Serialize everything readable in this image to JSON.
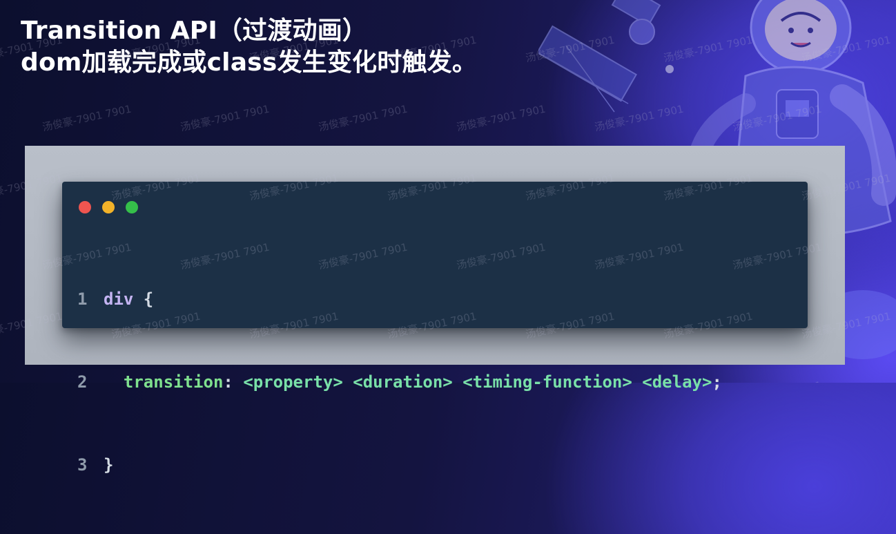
{
  "slide": {
    "title_line1": "Transition API（过渡动画）",
    "title_line2": "dom加载完成或class发生变化时触发。"
  },
  "code_window": {
    "lines": [
      {
        "num": "1",
        "selector": "div",
        "brace": " {"
      },
      {
        "num": "2",
        "indent": "  ",
        "property": "transition",
        "colon": ": ",
        "value": "<property> <duration> <timing-function> <delay>",
        "semi": ";"
      },
      {
        "num": "3",
        "brace": "}"
      }
    ]
  },
  "watermark": {
    "text": "汤俊豪-7901 7901"
  },
  "colors": {
    "accent_purple": "#4a3fd9",
    "code_bg": "#1c3046",
    "dot_red": "#ee5550",
    "dot_yellow": "#f2b229",
    "dot_green": "#35bf4a",
    "code_green": "#7fe08e"
  }
}
